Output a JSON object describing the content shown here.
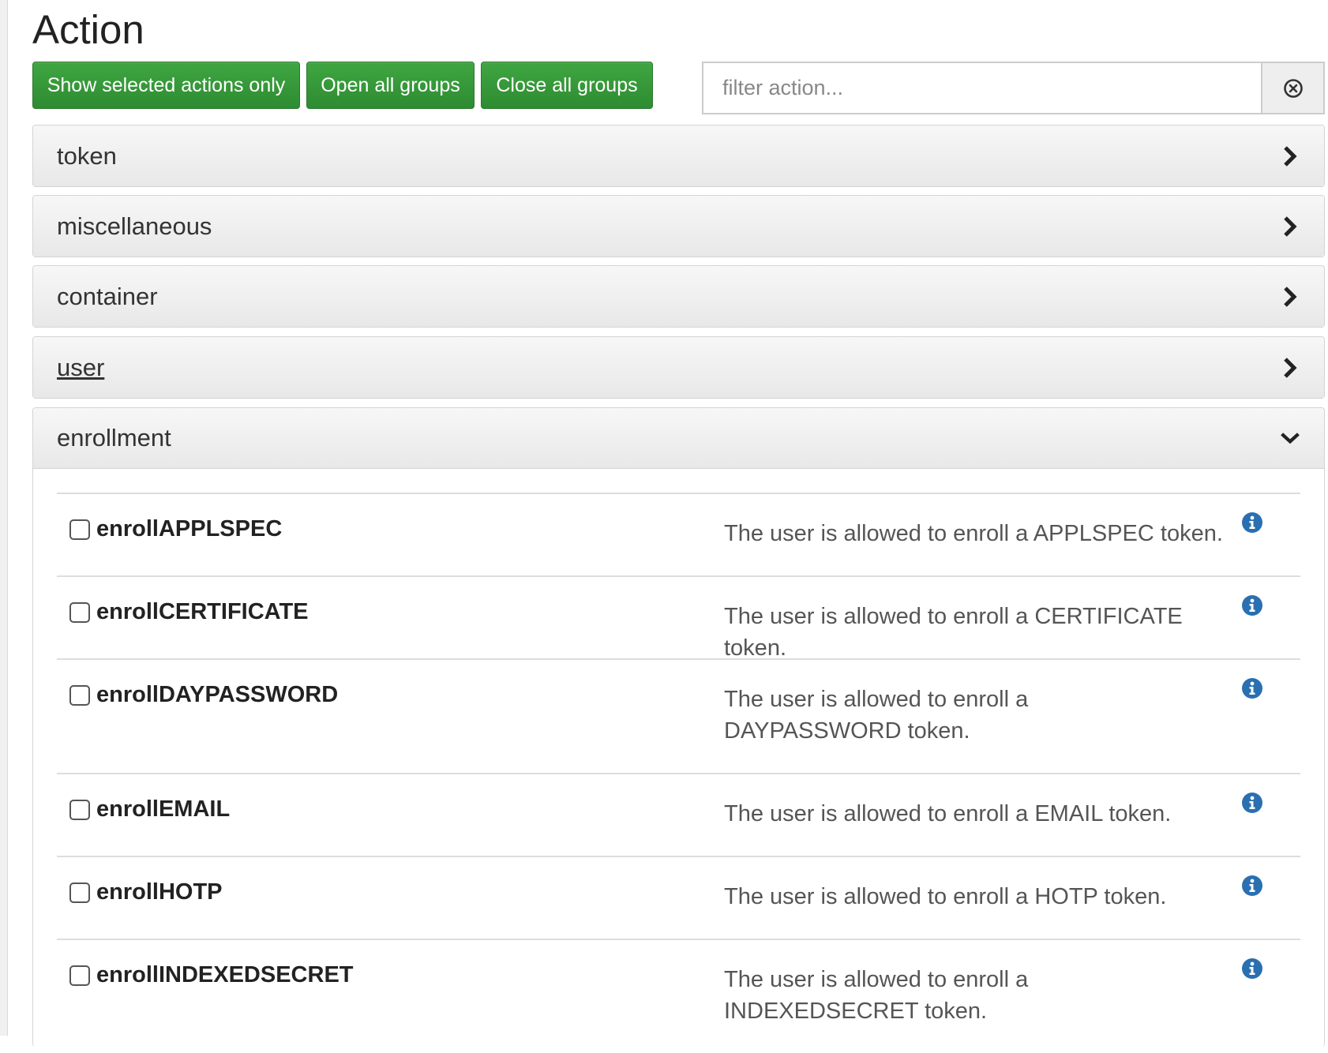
{
  "page": {
    "title": "Action"
  },
  "toolbar": {
    "show_selected_label": "Show selected actions only",
    "open_all_label": "Open all groups",
    "close_all_label": "Close all groups",
    "filter_placeholder": "filter action...",
    "filter_value": "",
    "clear_icon": "circle-x-icon"
  },
  "groups": [
    {
      "label": "token",
      "expanded": false,
      "underlined": false,
      "icon": "chevron-right-icon"
    },
    {
      "label": "miscellaneous",
      "expanded": false,
      "underlined": false,
      "icon": "chevron-right-icon"
    },
    {
      "label": "container",
      "expanded": false,
      "underlined": false,
      "icon": "chevron-right-icon"
    },
    {
      "label": "user",
      "expanded": false,
      "underlined": true,
      "icon": "chevron-right-icon"
    },
    {
      "label": "enrollment",
      "expanded": true,
      "underlined": false,
      "icon": "chevron-down-icon"
    }
  ],
  "enrollment_actions": [
    {
      "name": "enrollAPPLSPEC",
      "description": "The user is allowed to enroll a APPLSPEC token.",
      "checked": false
    },
    {
      "name": "enrollCERTIFICATE",
      "description": "The user is allowed to enroll a CERTIFICATE token.",
      "checked": false
    },
    {
      "name": "enrollDAYPASSWORD",
      "description": "The user is allowed to enroll a DAYPASSWORD token.",
      "checked": false
    },
    {
      "name": "enrollEMAIL",
      "description": "The user is allowed to enroll a EMAIL token.",
      "checked": false
    },
    {
      "name": "enrollHOTP",
      "description": "The user is allowed to enroll a HOTP token.",
      "checked": false
    },
    {
      "name": "enrollINDEXEDSECRET",
      "description": "The user is allowed to enroll a INDEXEDSECRET token.",
      "checked": false
    }
  ],
  "colors": {
    "button_green": "#2e8b32",
    "info_blue": "#2a6fb0",
    "header_gray": "#e8e8e8"
  }
}
